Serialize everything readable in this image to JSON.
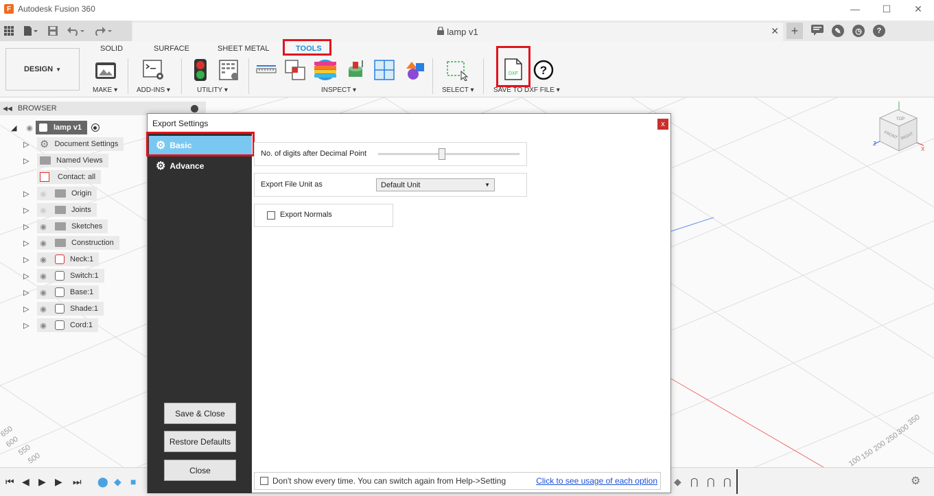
{
  "window": {
    "title": "Autodesk Fusion 360",
    "logo_letter": "F",
    "minimize": "—",
    "maximize": "☐",
    "close": "✕"
  },
  "document_tab": {
    "title": "lamp v1",
    "close": "✕"
  },
  "ribbon": {
    "workspace": "DESIGN",
    "tabs": [
      "SOLID",
      "SURFACE",
      "SHEET METAL",
      "TOOLS"
    ],
    "active_tab": "TOOLS",
    "groups": [
      "MAKE",
      "ADD-INS",
      "UTILITY",
      "INSPECT",
      "SELECT",
      "SAVE TO DXF FILE"
    ],
    "dxf_icon_text": "DXF",
    "help_icon": "?"
  },
  "browser": {
    "title": "BROWSER",
    "root": "lamp v1",
    "items": [
      {
        "label": "Document Settings",
        "icon": "gear-icon"
      },
      {
        "label": "Named Views",
        "icon": "folder-icon"
      },
      {
        "label": "Contact: all",
        "icon": "contact-icon"
      },
      {
        "label": "Origin",
        "icon": "folder-icon"
      },
      {
        "label": "Joints",
        "icon": "folder-icon"
      },
      {
        "label": "Sketches",
        "icon": "folder-icon"
      },
      {
        "label": "Construction",
        "icon": "folder-icon"
      },
      {
        "label": "Neck:1",
        "icon": "component-icon"
      },
      {
        "label": "Switch:1",
        "icon": "component-icon"
      },
      {
        "label": "Base:1",
        "icon": "component-icon"
      },
      {
        "label": "Shade:1",
        "icon": "component-icon"
      },
      {
        "label": "Cord:1",
        "icon": "component-icon"
      }
    ]
  },
  "viewcube": {
    "top": "TOP",
    "front": "FRONT",
    "right": "RIGHT",
    "x": "X",
    "z": "Z"
  },
  "grid_labels": {
    "left": [
      "650",
      "600",
      "550",
      "500"
    ],
    "right": [
      "350",
      "300",
      "250",
      "200",
      "150",
      "100"
    ]
  },
  "dialog": {
    "title": "Export Settings",
    "close": "x",
    "sidebar": {
      "basic": "Basic",
      "advance": "Advance",
      "save_close": "Save & Close",
      "restore_defaults": "Restore Defaults",
      "close": "Close"
    },
    "options": {
      "decimal_label": "No. of digits after Decimal Point",
      "decimal_value_fraction": 0.45,
      "unit_label": "Export File Unit as",
      "unit_value": "Default Unit",
      "normals_label": "Export Normals",
      "normals_checked": false
    },
    "footer": {
      "dont_show": "Don't show every time. You can switch again from Help->Setting",
      "dont_show_checked": false,
      "link": "Click to see usage of each option"
    }
  },
  "colors": {
    "accent": "#1a8fd8",
    "highlight": "#e0141e",
    "active_sidebar": "#7ac8f2",
    "dialog_sidebar": "#303030"
  }
}
